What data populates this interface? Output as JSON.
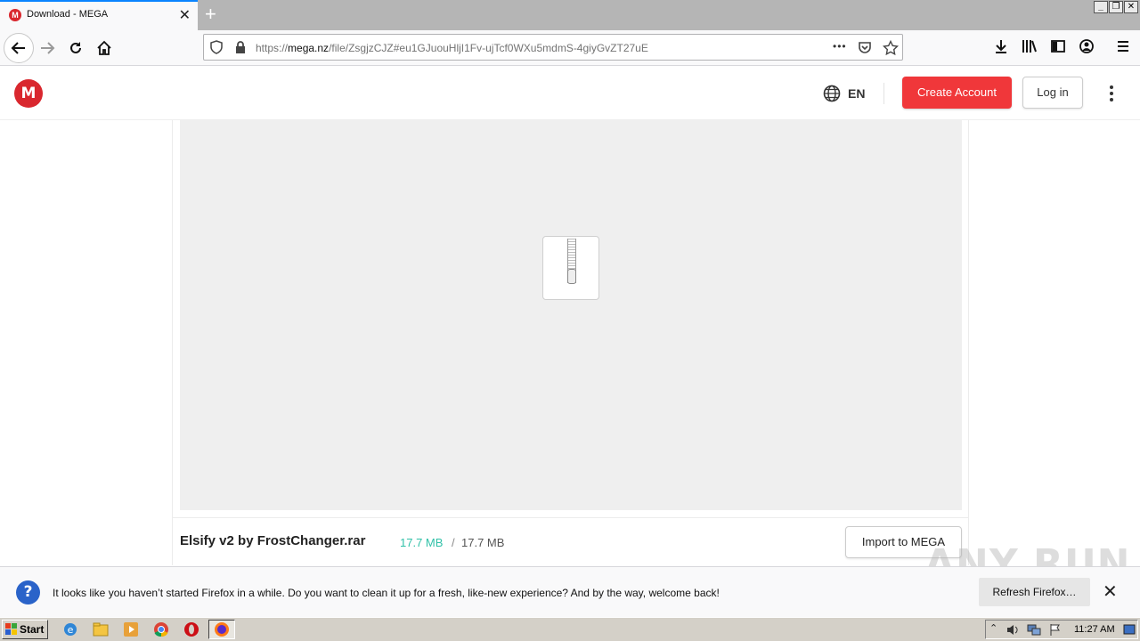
{
  "browser": {
    "tab_title": "Download - MEGA",
    "tab_favicon_letter": "M",
    "new_tab_symbol": "+",
    "tab_close_symbol": "✕",
    "window_controls": [
      "_",
      "❐",
      "✕"
    ],
    "url_prefix": "https://",
    "url_domain": "mega.nz",
    "url_path": "/file/ZsgjzCJZ#eu1GJuouHljI1Fv-ujTcf0WXu5mdmS-4giyGvZT27uE",
    "url_more": "•••"
  },
  "mega": {
    "logo_letter": "M",
    "language": "EN",
    "create_account_label": "Create Account",
    "login_label": "Log in",
    "brand_color": "#d9272e"
  },
  "file": {
    "name": "Elsify v2 by FrostChanger.rar",
    "size_downloaded": "17.7 MB",
    "size_separator": "/",
    "size_total": "17.7 MB",
    "import_label": "Import to MEGA"
  },
  "notification": {
    "icon_symbol": "?",
    "message": "It looks like you haven’t started Firefox in a while. Do you want to clean it up for a fresh, like-new experience? And by the way, welcome back!",
    "refresh_label": "Refresh Firefox…",
    "close_symbol": "✕"
  },
  "watermark": "ANY RUN",
  "taskbar": {
    "start_label": "Start",
    "clock": "11:27 AM"
  }
}
